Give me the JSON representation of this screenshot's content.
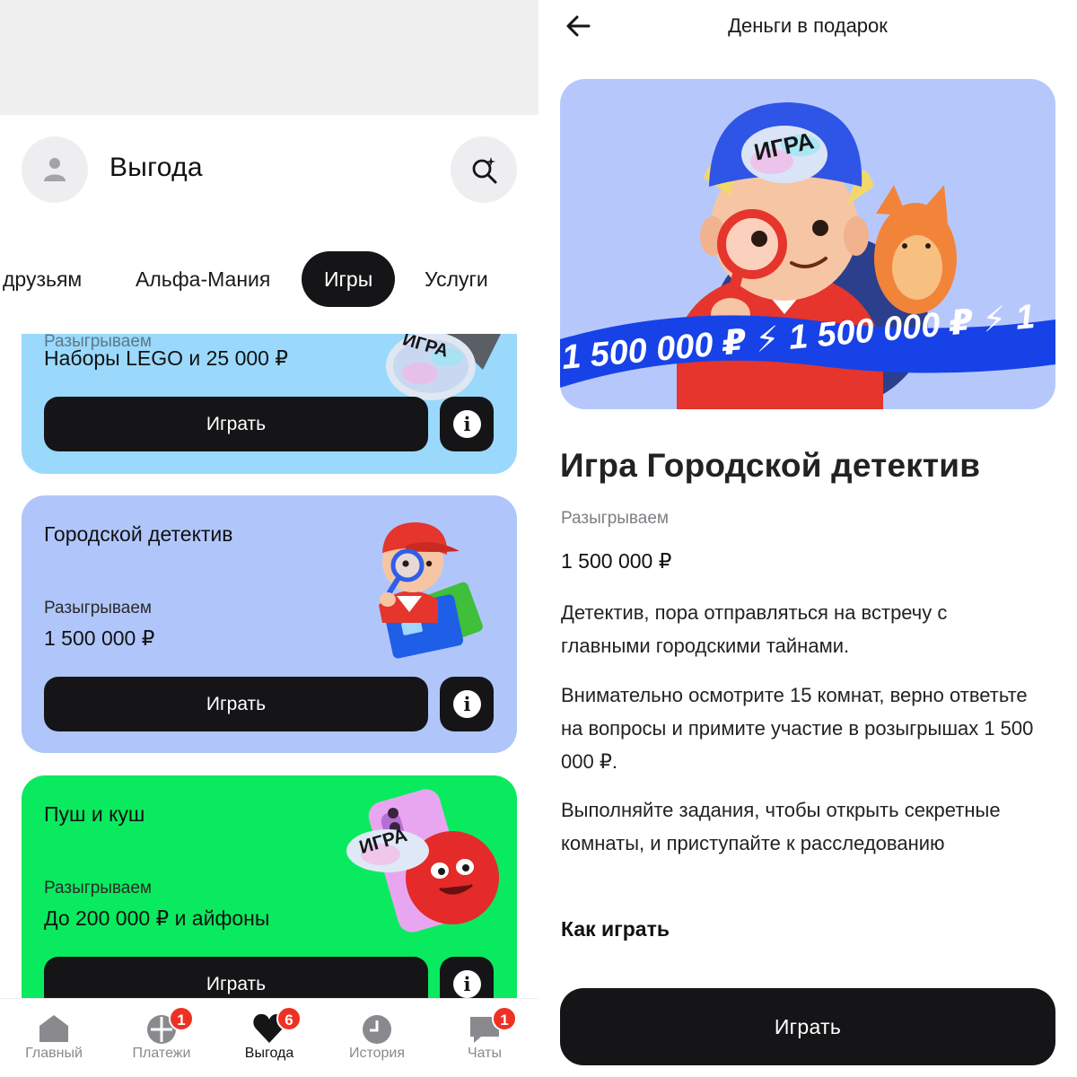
{
  "left": {
    "header": {
      "title": "Выгода"
    },
    "tabs": [
      {
        "label": "друзьям"
      },
      {
        "label": "Альфа-Мания"
      },
      {
        "label": "Игры"
      },
      {
        "label": "Услуги"
      }
    ],
    "cards": [
      {
        "subtitle": "Разыгрываем",
        "prize": "Наборы LEGO и 25 000 ₽",
        "badge": "ИГРА",
        "button": "Играть",
        "color": "#9ad9fb"
      },
      {
        "title": "Городской детектив",
        "subtitle": "Разыгрываем",
        "prize": "1 500 000 ₽",
        "button": "Играть",
        "color": "#b0c6fb"
      },
      {
        "title": "Пуш и куш",
        "subtitle": "Разыгрываем",
        "prize": "До 200 000 ₽ и айфоны",
        "badge": "ИГРА",
        "button": "Играть",
        "color": "#0aea5e"
      }
    ],
    "bottom_nav": [
      {
        "label": "Главный",
        "icon": "home-icon"
      },
      {
        "label": "Платежи",
        "icon": "payments-icon",
        "badge": "1"
      },
      {
        "label": "Выгода",
        "icon": "heart-icon",
        "badge": "6",
        "active": true
      },
      {
        "label": "История",
        "icon": "clock-icon"
      },
      {
        "label": "Чаты",
        "icon": "chat-icon",
        "badge": "1"
      }
    ]
  },
  "right": {
    "title": "Деньги в подарок",
    "hero": {
      "badge": "ИГРА",
      "ribbon": "1 500 000 ₽ ⚡ 1 500 000 ₽ ⚡ 1"
    },
    "game_title": "Игра Городской детектив",
    "subtitle": "Разыгрываем",
    "prize": "1 500 000 ₽",
    "paragraphs": [
      "Детектив, пора отправляться на встречу с главными городскими тайнами.",
      "Внимательно осмотрите 15 комнат, верно ответьте на вопросы и примите участие в розыгрышах 1 500 000 ₽.",
      "Выполняйте задания, чтобы открыть секретные комнаты, и приступайте к расследованию"
    ],
    "how_to_play": "Как играть",
    "button": "Играть"
  },
  "colors": {
    "accent_dark": "#151517",
    "badge_red": "#ef3124",
    "card_blue": "#9ad9fb",
    "card_lavender": "#b0c6fb",
    "card_green": "#0aea5e",
    "ribbon_blue": "#1742e8"
  }
}
